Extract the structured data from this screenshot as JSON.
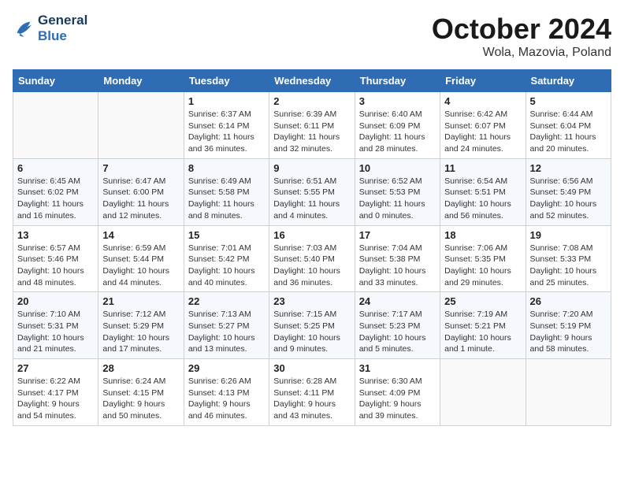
{
  "logo": {
    "line1": "General",
    "line2": "Blue"
  },
  "title": "October 2024",
  "subtitle": "Wola, Mazovia, Poland",
  "weekdays": [
    "Sunday",
    "Monday",
    "Tuesday",
    "Wednesday",
    "Thursday",
    "Friday",
    "Saturday"
  ],
  "weeks": [
    [
      {
        "day": "",
        "sunrise": "",
        "sunset": "",
        "daylight": ""
      },
      {
        "day": "",
        "sunrise": "",
        "sunset": "",
        "daylight": ""
      },
      {
        "day": "1",
        "sunrise": "Sunrise: 6:37 AM",
        "sunset": "Sunset: 6:14 PM",
        "daylight": "Daylight: 11 hours and 36 minutes."
      },
      {
        "day": "2",
        "sunrise": "Sunrise: 6:39 AM",
        "sunset": "Sunset: 6:11 PM",
        "daylight": "Daylight: 11 hours and 32 minutes."
      },
      {
        "day": "3",
        "sunrise": "Sunrise: 6:40 AM",
        "sunset": "Sunset: 6:09 PM",
        "daylight": "Daylight: 11 hours and 28 minutes."
      },
      {
        "day": "4",
        "sunrise": "Sunrise: 6:42 AM",
        "sunset": "Sunset: 6:07 PM",
        "daylight": "Daylight: 11 hours and 24 minutes."
      },
      {
        "day": "5",
        "sunrise": "Sunrise: 6:44 AM",
        "sunset": "Sunset: 6:04 PM",
        "daylight": "Daylight: 11 hours and 20 minutes."
      }
    ],
    [
      {
        "day": "6",
        "sunrise": "Sunrise: 6:45 AM",
        "sunset": "Sunset: 6:02 PM",
        "daylight": "Daylight: 11 hours and 16 minutes."
      },
      {
        "day": "7",
        "sunrise": "Sunrise: 6:47 AM",
        "sunset": "Sunset: 6:00 PM",
        "daylight": "Daylight: 11 hours and 12 minutes."
      },
      {
        "day": "8",
        "sunrise": "Sunrise: 6:49 AM",
        "sunset": "Sunset: 5:58 PM",
        "daylight": "Daylight: 11 hours and 8 minutes."
      },
      {
        "day": "9",
        "sunrise": "Sunrise: 6:51 AM",
        "sunset": "Sunset: 5:55 PM",
        "daylight": "Daylight: 11 hours and 4 minutes."
      },
      {
        "day": "10",
        "sunrise": "Sunrise: 6:52 AM",
        "sunset": "Sunset: 5:53 PM",
        "daylight": "Daylight: 11 hours and 0 minutes."
      },
      {
        "day": "11",
        "sunrise": "Sunrise: 6:54 AM",
        "sunset": "Sunset: 5:51 PM",
        "daylight": "Daylight: 10 hours and 56 minutes."
      },
      {
        "day": "12",
        "sunrise": "Sunrise: 6:56 AM",
        "sunset": "Sunset: 5:49 PM",
        "daylight": "Daylight: 10 hours and 52 minutes."
      }
    ],
    [
      {
        "day": "13",
        "sunrise": "Sunrise: 6:57 AM",
        "sunset": "Sunset: 5:46 PM",
        "daylight": "Daylight: 10 hours and 48 minutes."
      },
      {
        "day": "14",
        "sunrise": "Sunrise: 6:59 AM",
        "sunset": "Sunset: 5:44 PM",
        "daylight": "Daylight: 10 hours and 44 minutes."
      },
      {
        "day": "15",
        "sunrise": "Sunrise: 7:01 AM",
        "sunset": "Sunset: 5:42 PM",
        "daylight": "Daylight: 10 hours and 40 minutes."
      },
      {
        "day": "16",
        "sunrise": "Sunrise: 7:03 AM",
        "sunset": "Sunset: 5:40 PM",
        "daylight": "Daylight: 10 hours and 36 minutes."
      },
      {
        "day": "17",
        "sunrise": "Sunrise: 7:04 AM",
        "sunset": "Sunset: 5:38 PM",
        "daylight": "Daylight: 10 hours and 33 minutes."
      },
      {
        "day": "18",
        "sunrise": "Sunrise: 7:06 AM",
        "sunset": "Sunset: 5:35 PM",
        "daylight": "Daylight: 10 hours and 29 minutes."
      },
      {
        "day": "19",
        "sunrise": "Sunrise: 7:08 AM",
        "sunset": "Sunset: 5:33 PM",
        "daylight": "Daylight: 10 hours and 25 minutes."
      }
    ],
    [
      {
        "day": "20",
        "sunrise": "Sunrise: 7:10 AM",
        "sunset": "Sunset: 5:31 PM",
        "daylight": "Daylight: 10 hours and 21 minutes."
      },
      {
        "day": "21",
        "sunrise": "Sunrise: 7:12 AM",
        "sunset": "Sunset: 5:29 PM",
        "daylight": "Daylight: 10 hours and 17 minutes."
      },
      {
        "day": "22",
        "sunrise": "Sunrise: 7:13 AM",
        "sunset": "Sunset: 5:27 PM",
        "daylight": "Daylight: 10 hours and 13 minutes."
      },
      {
        "day": "23",
        "sunrise": "Sunrise: 7:15 AM",
        "sunset": "Sunset: 5:25 PM",
        "daylight": "Daylight: 10 hours and 9 minutes."
      },
      {
        "day": "24",
        "sunrise": "Sunrise: 7:17 AM",
        "sunset": "Sunset: 5:23 PM",
        "daylight": "Daylight: 10 hours and 5 minutes."
      },
      {
        "day": "25",
        "sunrise": "Sunrise: 7:19 AM",
        "sunset": "Sunset: 5:21 PM",
        "daylight": "Daylight: 10 hours and 1 minute."
      },
      {
        "day": "26",
        "sunrise": "Sunrise: 7:20 AM",
        "sunset": "Sunset: 5:19 PM",
        "daylight": "Daylight: 9 hours and 58 minutes."
      }
    ],
    [
      {
        "day": "27",
        "sunrise": "Sunrise: 6:22 AM",
        "sunset": "Sunset: 4:17 PM",
        "daylight": "Daylight: 9 hours and 54 minutes."
      },
      {
        "day": "28",
        "sunrise": "Sunrise: 6:24 AM",
        "sunset": "Sunset: 4:15 PM",
        "daylight": "Daylight: 9 hours and 50 minutes."
      },
      {
        "day": "29",
        "sunrise": "Sunrise: 6:26 AM",
        "sunset": "Sunset: 4:13 PM",
        "daylight": "Daylight: 9 hours and 46 minutes."
      },
      {
        "day": "30",
        "sunrise": "Sunrise: 6:28 AM",
        "sunset": "Sunset: 4:11 PM",
        "daylight": "Daylight: 9 hours and 43 minutes."
      },
      {
        "day": "31",
        "sunrise": "Sunrise: 6:30 AM",
        "sunset": "Sunset: 4:09 PM",
        "daylight": "Daylight: 9 hours and 39 minutes."
      },
      {
        "day": "",
        "sunrise": "",
        "sunset": "",
        "daylight": ""
      },
      {
        "day": "",
        "sunrise": "",
        "sunset": "",
        "daylight": ""
      }
    ]
  ]
}
